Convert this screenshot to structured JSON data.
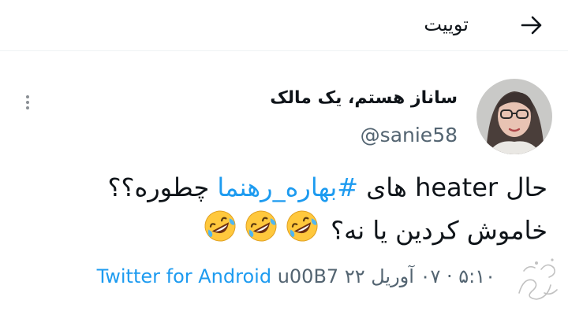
{
  "header": {
    "title": "توییت",
    "back_icon": "arrow-back-icon"
  },
  "tweet": {
    "author": {
      "name": "ساناز هستم، یک مالک",
      "handle": "@sanie58"
    },
    "text": {
      "line1_prefix": "حال ",
      "line1_word": "heater",
      "line1_mid": " های ",
      "hashtag": "#بهاره_رهنما",
      "line1_suffix": " چطوره؟؟",
      "line2": "خاموش کردین یا نه؟"
    },
    "emoji": {
      "name": "rolling-on-the-floor-laughing-icon",
      "count": 3
    },
    "meta": {
      "time_and_date": "۵:۱۰ · ۰۷ آوریل ۲۲",
      "separator": "u00B7",
      "source": "Twitter for Android"
    },
    "menu_icon": "more-vertical-icon"
  },
  "colors": {
    "accent": "#1d9bf0",
    "secondary_text": "#536471",
    "primary_text": "#0f1419",
    "emoji_face": "#ffc83d"
  }
}
